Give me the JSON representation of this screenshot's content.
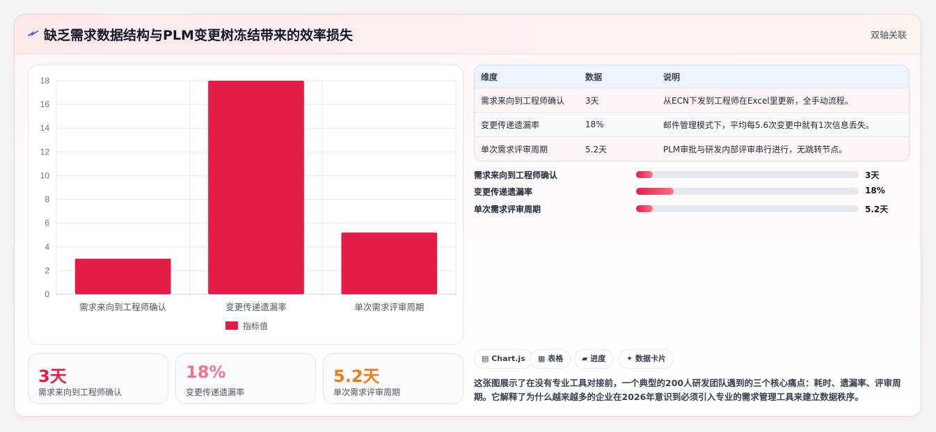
{
  "header": {
    "title": "缺乏需求数据结构与PLM变更树冻结带来的效率损失",
    "tag": "双轴关联"
  },
  "colors": {
    "accent": "#e11d48",
    "pink": "#f87192",
    "orange": "#f07c18"
  },
  "chart_data": {
    "type": "bar",
    "categories": [
      "需求来向到工程师确认",
      "变更传递遗漏率",
      "单次需求评审周期"
    ],
    "series": [
      {
        "name": "指标值",
        "values": [
          3,
          18,
          5.2
        ]
      }
    ],
    "ylim": [
      0,
      18
    ],
    "yticks": [
      0,
      2,
      4,
      6,
      8,
      10,
      12,
      14,
      16,
      18
    ],
    "grid": true,
    "legend": "bottom"
  },
  "stats": [
    {
      "value": "3天",
      "label": "需求来向到工程师确认"
    },
    {
      "value": "18%",
      "label": "变更传递遗漏率"
    },
    {
      "value": "5.2天",
      "label": "单次需求评审周期"
    }
  ],
  "table": {
    "headers": [
      "维度",
      "数据",
      "说明"
    ],
    "rows": [
      [
        "需求来向到工程师确认",
        "3天",
        "从ECN下发到工程师在Excel里更新，全手动流程。"
      ],
      [
        "变更传递遗漏率",
        "18%",
        "邮件管理模式下，平均每5.6次变更中就有1次信息丢失。"
      ],
      [
        "单次需求评审周期",
        "5.2天",
        "PLM审批与研发内部评审串行进行，无跳转节点。"
      ]
    ]
  },
  "progress": [
    {
      "label": "需求来向到工程师确认",
      "value": "3天",
      "fraction": 0.075
    },
    {
      "label": "变更传递遗漏率",
      "value": "18%",
      "fraction": 0.17
    },
    {
      "label": "单次需求评审周期",
      "value": "5.2天",
      "fraction": 0.075
    }
  ],
  "chips": [
    "Chart.js",
    "表格",
    "进度",
    "数据卡片"
  ],
  "description": "这张图展示了在没有专业工具对接前，一个典型的200人研发团队遇到的三个核心痛点：耗时、遗漏率、评审周期。它解释了为什么越来越多的企业在2026年意识到必须引入专业的需求管理工具来建立数据秩序。"
}
